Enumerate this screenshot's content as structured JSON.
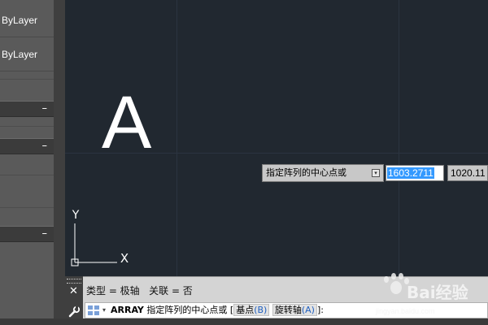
{
  "properties": {
    "rows": [
      "ByLayer",
      "ByLayer"
    ]
  },
  "canvas": {
    "text_entity": "A",
    "ucs": {
      "y_label": "Y",
      "x_label": "X"
    }
  },
  "dynamic_input": {
    "prompt": "指定阵列的中心点或",
    "x_value": "1603.2711",
    "y_value": "1020.11"
  },
  "command": {
    "history": "类型 = 极轴   关联 = 否",
    "name": "ARRAY",
    "prompt": "指定阵列的中心点或",
    "bracket_open": "[",
    "options": [
      {
        "label": "基点",
        "key": "(B)"
      },
      {
        "label": "旋转轴",
        "key": "(A)"
      }
    ],
    "bracket_close": "]:"
  },
  "watermark": {
    "text": "Bai经验",
    "url": "jingyan.baidu.com"
  },
  "colors": {
    "canvas_bg": "#212830",
    "selection": "#3399ff",
    "command_bg": "#d4d4d4"
  }
}
